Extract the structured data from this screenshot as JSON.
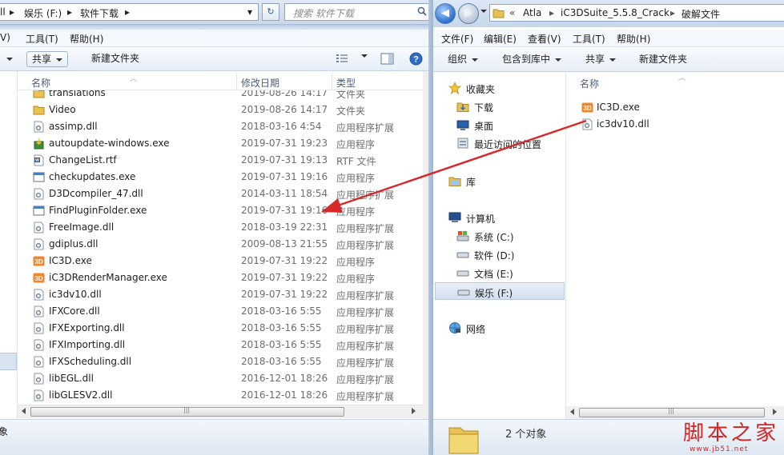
{
  "left": {
    "address": {
      "part_cut": "ll",
      "drive": "娱乐 (F:)",
      "folder": "软件下载"
    },
    "search_placeholder": "搜索 软件下载",
    "menu": {
      "view_cut": "V)",
      "tools": "工具(T)",
      "help": "帮助(H)"
    },
    "toolbar": {
      "share": "共享",
      "new_folder": "新建文件夹"
    },
    "columns": {
      "name": "名称",
      "date": "修改日期",
      "type": "类型"
    },
    "rows": [
      {
        "name": "translations",
        "date": "2019-08-26 14:17",
        "type": "文件夹",
        "icon": "folder"
      },
      {
        "name": "Video",
        "date": "2019-08-26 14:17",
        "type": "文件夹",
        "icon": "folder"
      },
      {
        "name": "assimp.dll",
        "date": "2018-03-16 4:54",
        "type": "应用程序扩展",
        "icon": "dll"
      },
      {
        "name": "autoupdate-windows.exe",
        "date": "2019-07-31 19:23",
        "type": "应用程序",
        "icon": "installer"
      },
      {
        "name": "ChangeList.rtf",
        "date": "2019-07-31 19:13",
        "type": "RTF 文件",
        "icon": "rtf"
      },
      {
        "name": "checkupdates.exe",
        "date": "2019-07-31 19:16",
        "type": "应用程序",
        "icon": "exe"
      },
      {
        "name": "D3Dcompiler_47.dll",
        "date": "2014-03-11 18:54",
        "type": "应用程序扩展",
        "icon": "dll"
      },
      {
        "name": "FindPluginFolder.exe",
        "date": "2019-07-31 19:16",
        "type": "应用程序",
        "icon": "exe"
      },
      {
        "name": "FreeImage.dll",
        "date": "2018-03-19 22:31",
        "type": "应用程序扩展",
        "icon": "dll"
      },
      {
        "name": "gdiplus.dll",
        "date": "2009-08-13 21:55",
        "type": "应用程序扩展",
        "icon": "dll"
      },
      {
        "name": "IC3D.exe",
        "date": "2019-07-31 19:22",
        "type": "应用程序",
        "icon": "ic3d"
      },
      {
        "name": "iC3DRenderManager.exe",
        "date": "2019-07-31 19:22",
        "type": "应用程序",
        "icon": "ic3d"
      },
      {
        "name": "ic3dv10.dll",
        "date": "2019-07-31 19:22",
        "type": "应用程序扩展",
        "icon": "dll"
      },
      {
        "name": "IFXCore.dll",
        "date": "2018-03-16 5:55",
        "type": "应用程序扩展",
        "icon": "dll"
      },
      {
        "name": "IFXExporting.dll",
        "date": "2018-03-16 5:55",
        "type": "应用程序扩展",
        "icon": "dll"
      },
      {
        "name": "IFXImporting.dll",
        "date": "2018-03-16 5:55",
        "type": "应用程序扩展",
        "icon": "dll"
      },
      {
        "name": "IFXScheduling.dll",
        "date": "2018-03-16 5:55",
        "type": "应用程序扩展",
        "icon": "dll"
      },
      {
        "name": "libEGL.dll",
        "date": "2016-12-01 18:26",
        "type": "应用程序扩展",
        "icon": "dll"
      },
      {
        "name": "libGLESV2.dll",
        "date": "2016-12-01 18:26",
        "type": "应用程序扩展",
        "icon": "dll"
      }
    ],
    "status_cut": "象"
  },
  "right": {
    "address": {
      "chev": "«",
      "p1": "Atla",
      "p2": "iC3DSuite_5.5.8_Crack",
      "p3": "破解文件"
    },
    "menu": {
      "file": "文件(F)",
      "edit": "编辑(E)",
      "view": "查看(V)",
      "tools": "工具(T)",
      "help": "帮助(H)"
    },
    "toolbar": {
      "organize": "组织",
      "include": "包含到库中",
      "share": "共享",
      "new_folder": "新建文件夹"
    },
    "nav": {
      "favorites": "收藏夹",
      "downloads": "下载",
      "desktop": "桌面",
      "recent": "最近访问的位置",
      "libraries": "库",
      "computer": "计算机",
      "drive_c": "系统 (C:)",
      "drive_d": "软件 (D:)",
      "drive_e": "文档 (E:)",
      "drive_f": "娱乐 (F:)",
      "network": "网络"
    },
    "column_name": "名称",
    "files": [
      {
        "name": "IC3D.exe",
        "icon": "ic3d"
      },
      {
        "name": "ic3dv10.dll",
        "icon": "dll"
      }
    ],
    "status_count": "2 个对象"
  },
  "watermark": {
    "main": "脚本之家",
    "url": "www.jb51.net"
  },
  "colors": {
    "arrow": "#d62828",
    "watermark": "#d82424",
    "selection": "#d3e0ef"
  }
}
